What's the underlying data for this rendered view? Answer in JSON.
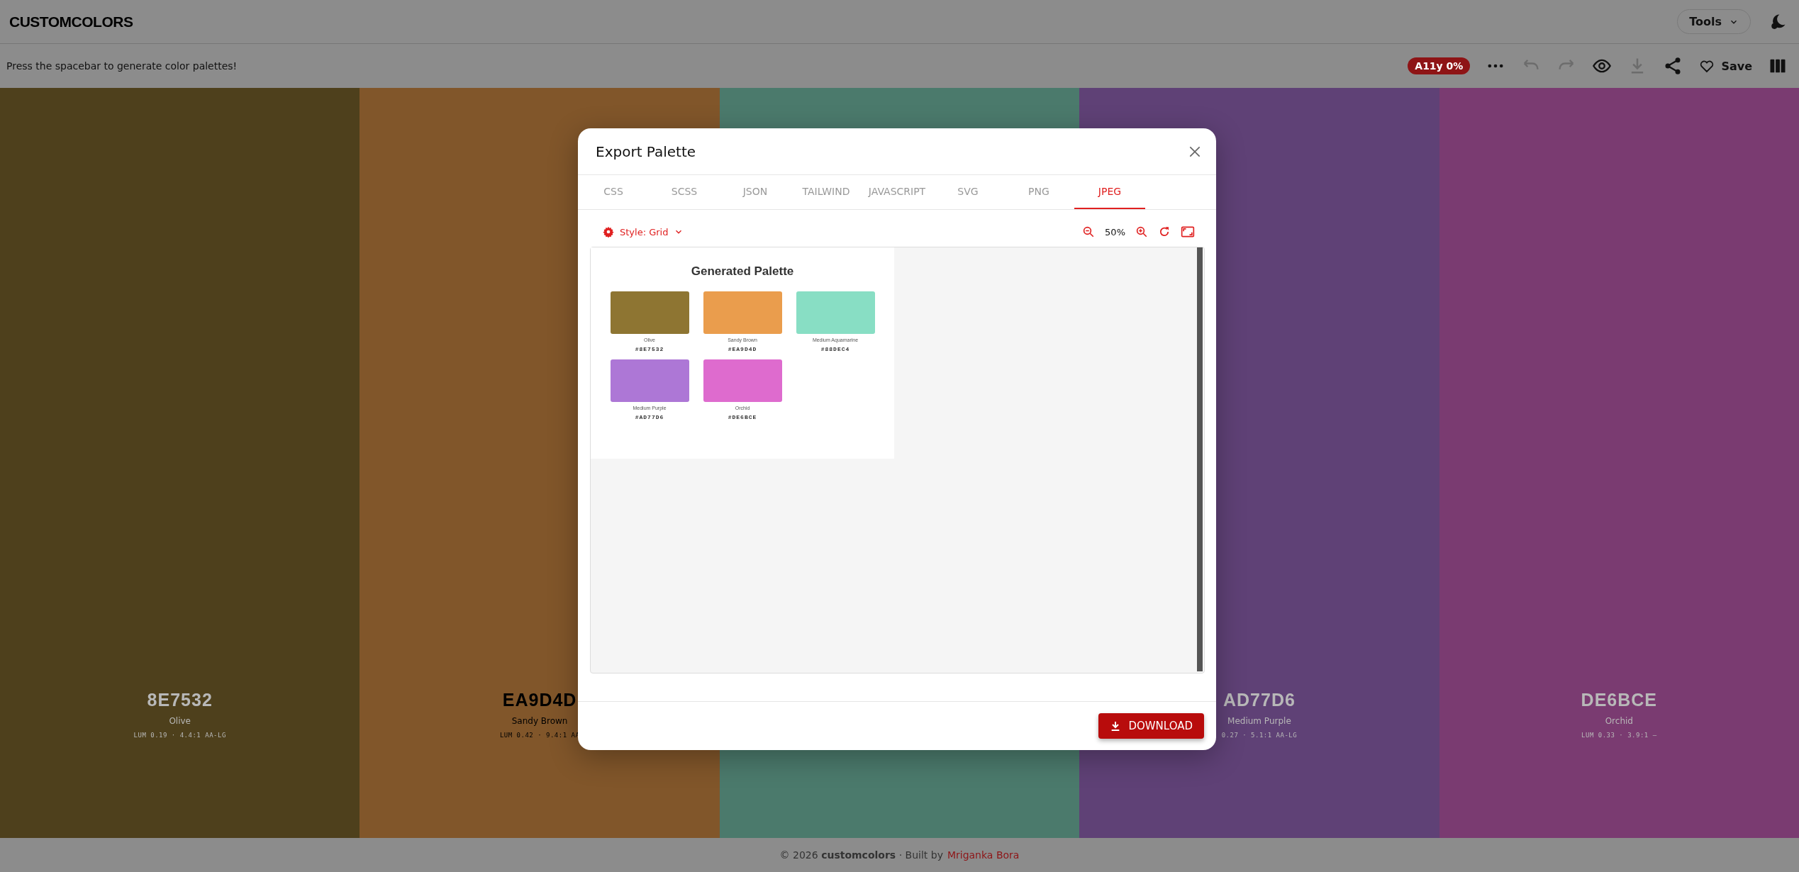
{
  "header": {
    "logo": "CUSTOMCOLORS",
    "tools_button": "Tools"
  },
  "toolbar": {
    "hint": "Press the spacebar to generate color palettes!",
    "a11y_badge": "A11y 0%",
    "actions": [
      {
        "kind": "more",
        "disabled": false
      },
      {
        "kind": "undo",
        "disabled": true
      },
      {
        "kind": "redo",
        "disabled": true
      },
      {
        "kind": "view",
        "disabled": false
      },
      {
        "kind": "download",
        "disabled": true
      },
      {
        "kind": "share",
        "disabled": false
      },
      {
        "kind": "save",
        "label": "Save",
        "disabled": false
      },
      {
        "kind": "columns",
        "disabled": false
      }
    ]
  },
  "columns": [
    {
      "color": "#4e401c",
      "hex": "8E7532",
      "name": "Olive",
      "stats": "LUM 0.19 · 4.4:1 AA-LG"
    },
    {
      "color": "#81562a",
      "hex": "EA9D4D",
      "name": "Sandy Brown",
      "stats": "LUM 0.42 · 9.4:1 AA"
    },
    {
      "color": "#4b7a6c"
    },
    {
      "color": "#5f4176",
      "hex": "AD77D6",
      "name": "Medium Purple",
      "stats": "0.27 · 5.1:1 AA-LG"
    },
    {
      "color": "#7a3b71",
      "hex": "DE6BCE",
      "name": "Orchid",
      "stats": "LUM 0.33 · 3.9:1 —"
    }
  ],
  "modal": {
    "title": "Export Palette",
    "tabs": [
      {
        "label": "CSS",
        "selected": false
      },
      {
        "label": "SCSS",
        "selected": false
      },
      {
        "label": "JSON",
        "selected": false
      },
      {
        "label": "TAILWIND",
        "selected": false
      },
      {
        "label": "JAVASCRIPT",
        "selected": false
      },
      {
        "label": "SVG",
        "selected": false
      },
      {
        "label": "PNG",
        "selected": false
      },
      {
        "label": "JPEG",
        "selected": true
      }
    ],
    "style_button": "Style: Grid",
    "zoom": "50%",
    "preview": {
      "title": "Generated Palette",
      "swatches": [
        {
          "color": "#8e7532",
          "name": "Olive",
          "hex": "#8E7532"
        },
        {
          "color": "#ea9d4d",
          "name": "Sandy Brown",
          "hex": "#EA9D4D"
        },
        {
          "color": "#88dec4",
          "name": "Medium Aquamarine",
          "hex": "#88DEC4"
        },
        {
          "color": "#ad77d6",
          "name": "Medium Purple",
          "hex": "#AD77D6"
        },
        {
          "color": "#de6bce",
          "name": "Orchid",
          "hex": "#DE6BCE"
        }
      ]
    },
    "download_button": "DOWNLOAD"
  },
  "footer": {
    "text": "© 2026 **customcolors** · Built by",
    "author_link": "Mriganka Bora"
  }
}
